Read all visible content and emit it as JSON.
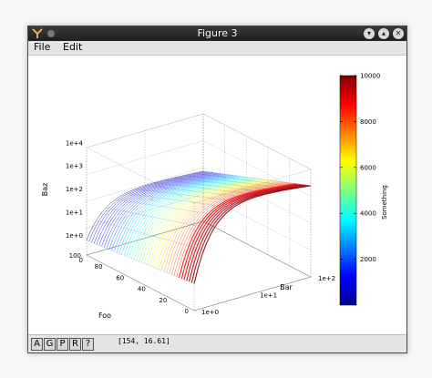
{
  "window": {
    "title": "Figure 3"
  },
  "menu": {
    "file": "File",
    "edit": "Edit"
  },
  "toolbar": {
    "buttons": [
      "A",
      "G",
      "P",
      "R",
      "?"
    ]
  },
  "status": {
    "coords": "[154, 16.61]"
  },
  "chart_data": {
    "type": "surface",
    "title": "",
    "axes": {
      "foo": {
        "label": "Foo",
        "ticks": [
          "0",
          "20",
          "40",
          "60",
          "80",
          "100"
        ],
        "range": [
          0,
          100
        ]
      },
      "bar": {
        "label": "Bar",
        "ticks": [
          "1e+0",
          "1e+1",
          "1e+2"
        ],
        "scale": "log",
        "range": [
          1,
          100
        ]
      },
      "baz": {
        "label": "Baz",
        "ticks": [
          "1e+0",
          "1e+1",
          "1e+2",
          "1e+3",
          "1e+4"
        ],
        "scale": "log",
        "range": [
          1,
          10000
        ]
      }
    },
    "colorbar": {
      "label": "Something",
      "ticks": [
        "2000",
        "4000",
        "6000",
        "8000",
        "10000"
      ],
      "range": [
        0,
        10000
      ],
      "colormap": "jet"
    },
    "grid": true
  }
}
